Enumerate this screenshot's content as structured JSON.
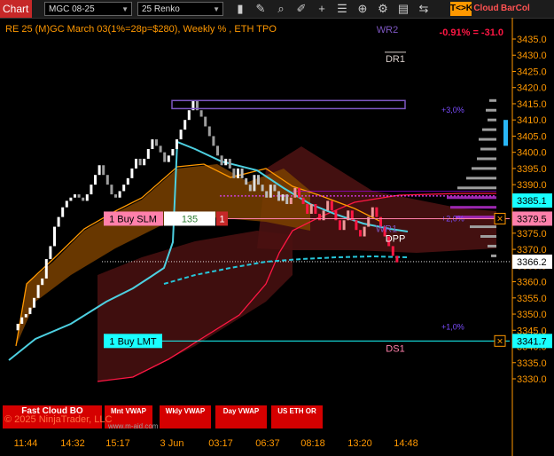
{
  "toolbar": {
    "chart_label": "Chart",
    "instrument": "MGC 08-25",
    "bar_type": "25 Renko",
    "icons": [
      "bar-style-icon",
      "draw-tools-icon",
      "zoom-icon",
      "drawing-toolbar-icon",
      "crosshair-icon",
      "indicators-icon",
      "strategies-icon",
      "properties-icon",
      "templates-icon"
    ],
    "tok_label": "T<>K",
    "cloud_label": "Cloud",
    "barcol_label": "BarCol"
  },
  "header": {
    "title": "RE 25 (M)GC March 03(1%=28p=$280), Weekly % , ETH TPO",
    "performance": "-0.91% = -31.0"
  },
  "chart_data": {
    "type": "line",
    "instrument": "MGC 08-25",
    "bar_type": "25 Renko",
    "ylim": [
      3325,
      3440
    ],
    "y_ticks": [
      3330,
      3335,
      3340,
      3345,
      3350,
      3355,
      3360,
      3365,
      3370,
      3375,
      3380,
      3385,
      3390,
      3395,
      3400,
      3405,
      3410,
      3415,
      3420,
      3425,
      3430,
      3435
    ],
    "x_ticks": [
      "11:44",
      "14:32",
      "15:17",
      "3 Jun",
      "03:17",
      "06:37",
      "08:18",
      "13:20",
      "14:48"
    ],
    "price_markers": [
      {
        "value": "3385.1",
        "color": "#18ffff"
      },
      {
        "value": "3379.5",
        "color": "#ff80ab"
      },
      {
        "value": "3366.2",
        "color": "#ffffff"
      },
      {
        "value": "3341.7",
        "color": "#18ffff"
      }
    ],
    "levels": [
      {
        "label": "DR1",
        "price": 3429
      },
      {
        "label": "WR2",
        "price": 3438
      },
      {
        "label": "WR1",
        "price": 3376.5
      },
      {
        "label": "DPP",
        "price": 3373.5
      },
      {
        "label": "DS1",
        "price": 3339.5
      }
    ],
    "vwap_percent_labels": [
      {
        "label": "+3,0%",
        "price": 3413
      },
      {
        "label": "+2,0%",
        "price": 3379.5
      },
      {
        "label": "+1,0%",
        "price": 3346
      }
    ],
    "orders": [
      {
        "label": "1 Buy SLM",
        "qty": "135",
        "count": "1",
        "price": 3379.5
      },
      {
        "label": "1 Buy LMT",
        "price": 3341.7
      }
    ],
    "series": [
      {
        "name": "close",
        "values": [
          3345,
          3347,
          3349,
          3350,
          3352,
          3355,
          3359,
          3361,
          3367,
          3371,
          3377,
          3380,
          3383,
          3385,
          3386,
          3387,
          3386,
          3385,
          3387,
          3390,
          3393,
          3396,
          3393,
          3390,
          3387,
          3386,
          3388,
          3390,
          3392,
          3395,
          3398,
          3396,
          3398,
          3401,
          3404,
          3402,
          3400,
          3397,
          3399,
          3401,
          3404,
          3407,
          3410,
          3413,
          3416,
          3413,
          3411,
          3408,
          3405,
          3402,
          3399,
          3396,
          3398,
          3395,
          3392,
          3395,
          3392,
          3390,
          3388,
          3393,
          3390,
          3388,
          3386,
          3390,
          3388,
          3385,
          3387,
          3384,
          3386,
          3389,
          3386,
          3384,
          3381,
          3384,
          3381,
          3379,
          3382,
          3385,
          3382,
          3379,
          3376,
          3379,
          3382,
          3379,
          3376,
          3374,
          3377,
          3380,
          3383,
          3380,
          3377,
          3374,
          3371,
          3368,
          3366
        ]
      }
    ]
  },
  "indicator_buttons": {
    "fast_cloud": "Fast Cloud BO",
    "mnt_vwap": "Mnt VWAP",
    "wkly_vwap": "Wkly VWAP",
    "day_vwap": "Day VWAP",
    "us_eth": "US ETH OR"
  },
  "footer": {
    "copyright": "© 2025 NinjaTrader, LLC",
    "watermark": "www.m-aid.com"
  }
}
